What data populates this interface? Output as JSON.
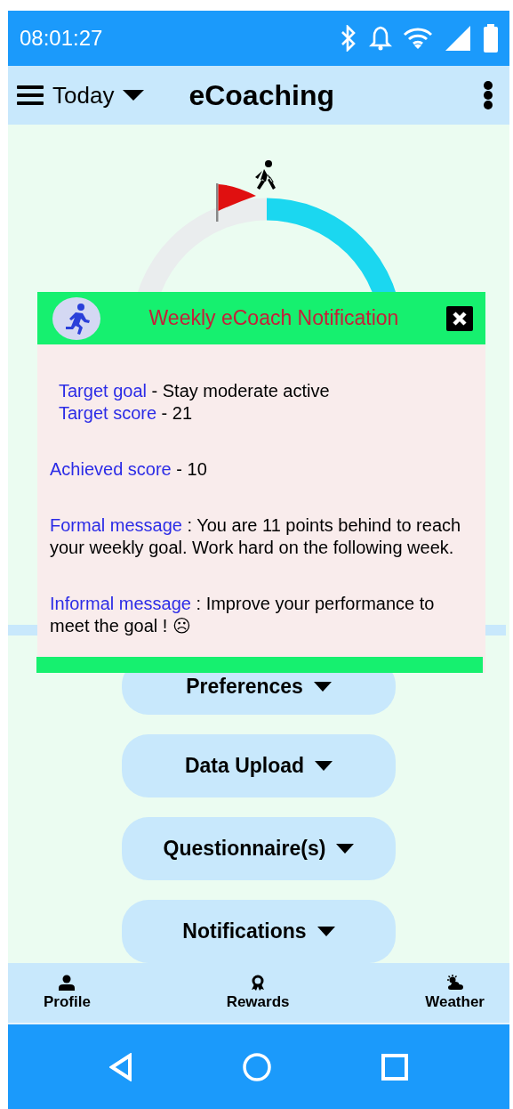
{
  "status_bar": {
    "time": "08:01:27"
  },
  "app_bar": {
    "period": "Today",
    "title": "eCoaching"
  },
  "menu_buttons": [
    {
      "label": "Preferences"
    },
    {
      "label": "Data Upload"
    },
    {
      "label": "Questionnaire(s)"
    },
    {
      "label": "Notifications"
    }
  ],
  "notification": {
    "title": "Weekly eCoach Notification",
    "sections": [
      {
        "lines": [
          {
            "label": "Target goal",
            "separator": " - ",
            "value": "Stay moderate active"
          },
          {
            "label": "Target score",
            "separator": " - ",
            "value": "21"
          }
        ]
      },
      {
        "lines": [
          {
            "label": "Achieved score",
            "separator": " - ",
            "value": "10"
          }
        ]
      },
      {
        "lines": [
          {
            "label": "Formal message",
            "separator": " :  ",
            "value": "You are 11 points behind to reach your weekly goal. Work hard on the following week."
          }
        ]
      },
      {
        "lines": [
          {
            "label": "Informal message",
            "separator": " :  ",
            "value": "Improve your performance to meet the goal ! ☹"
          }
        ]
      }
    ]
  },
  "bottom_nav": [
    {
      "label": "Profile"
    },
    {
      "label": "Rewards"
    },
    {
      "label": "Weather"
    }
  ]
}
